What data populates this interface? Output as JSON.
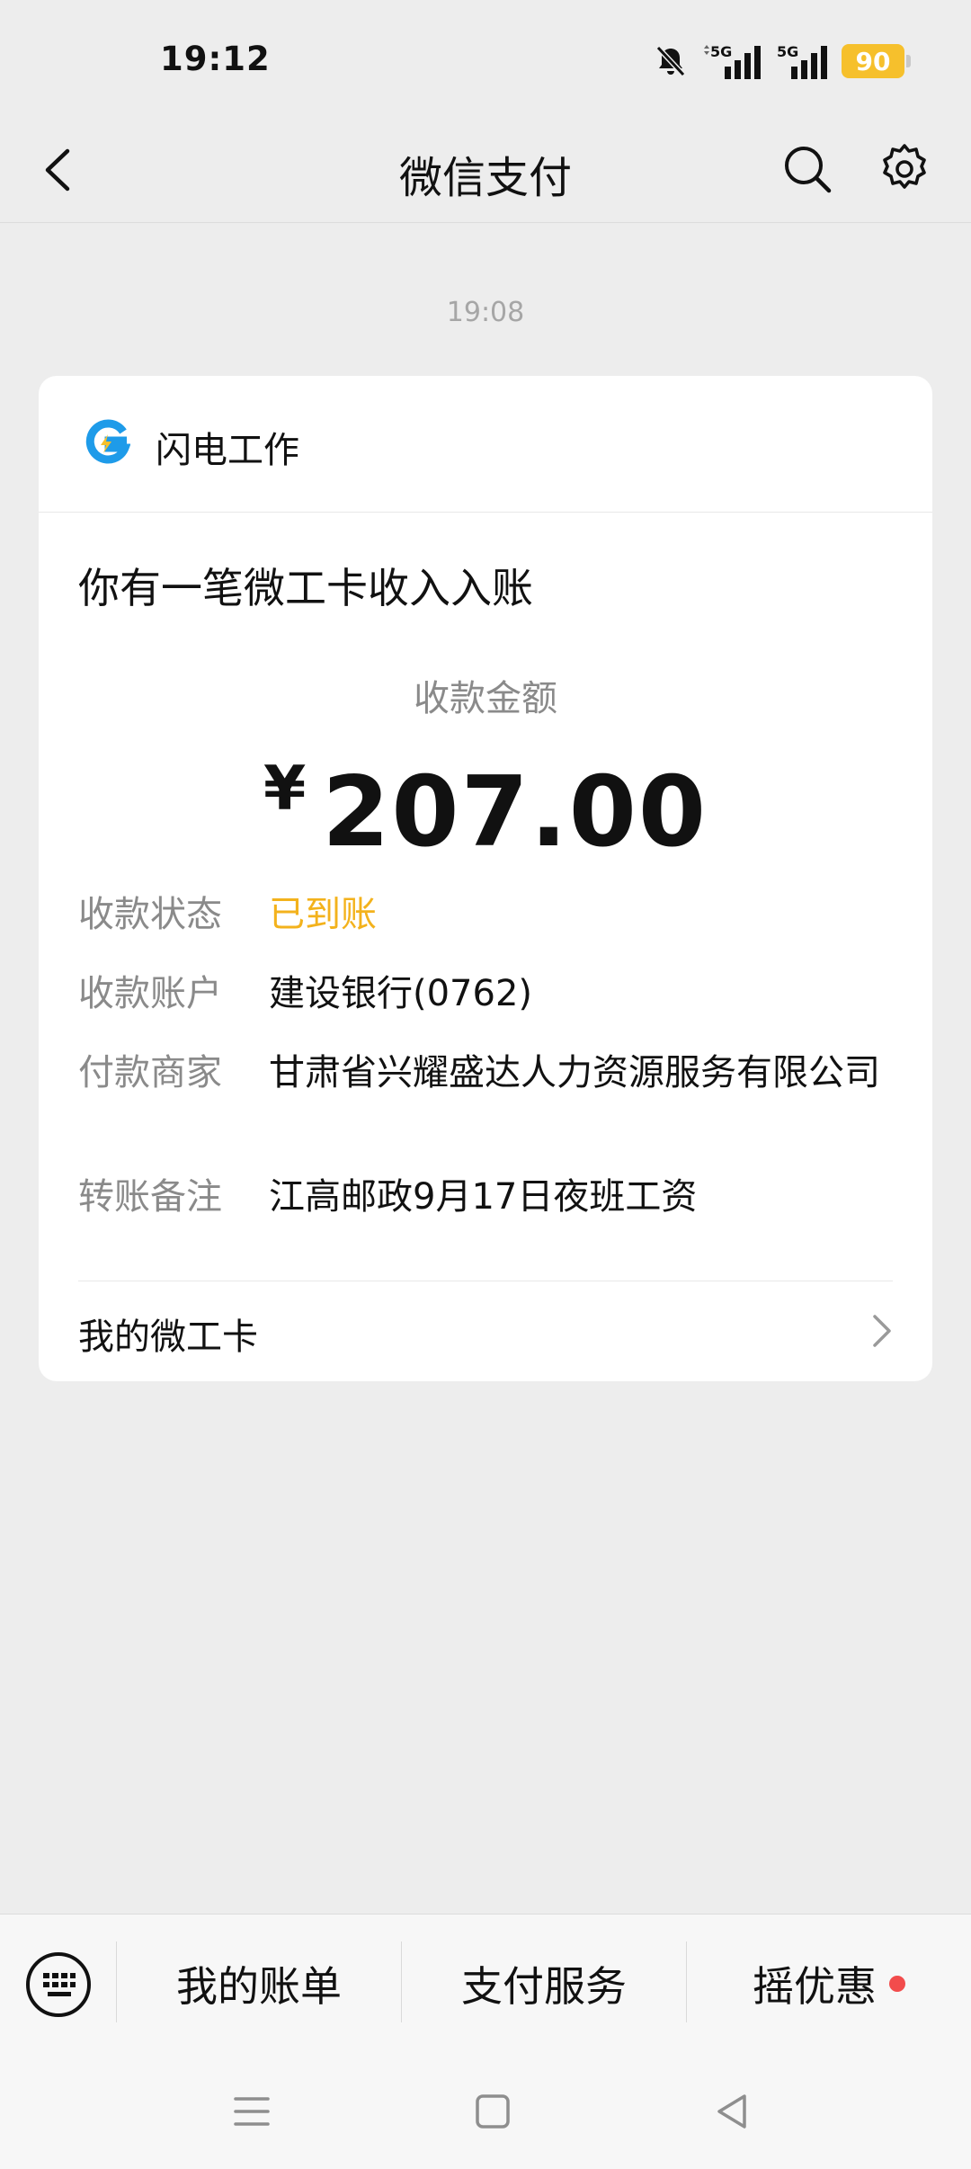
{
  "status_bar": {
    "time": "19:12",
    "battery": "90",
    "icons": [
      "bell-muted-icon",
      "signal-5g-icon",
      "signal-5g-icon",
      "battery-icon"
    ]
  },
  "header": {
    "title": "微信支付",
    "icons": [
      "back-arrow-icon",
      "search-icon",
      "gear-icon"
    ]
  },
  "message": {
    "time": "19:08",
    "merchant": "闪电工作",
    "title": "你有一笔微工卡收入入账",
    "amount_label": "收款金额",
    "currency": "¥",
    "amount": "207.00",
    "details": [
      {
        "label": "收款状态",
        "value": "已到账"
      },
      {
        "label": "收款账户",
        "value": "建设银行(0762)"
      },
      {
        "label": "付款商家",
        "value": "甘肃省兴耀盛达人力资源服务有限公司"
      },
      {
        "label": "转账备注",
        "value": "江高邮政9月17日夜班工资"
      }
    ],
    "footer_link": "我的微工卡"
  },
  "bottom_menu": {
    "items": [
      "我的账单",
      "支付服务",
      "摇优惠"
    ]
  },
  "colors": {
    "accent_status": "#f3b21c",
    "battery": "#f6c02c",
    "badge": "#f24c4c",
    "logo_blue": "#1e9be9"
  }
}
